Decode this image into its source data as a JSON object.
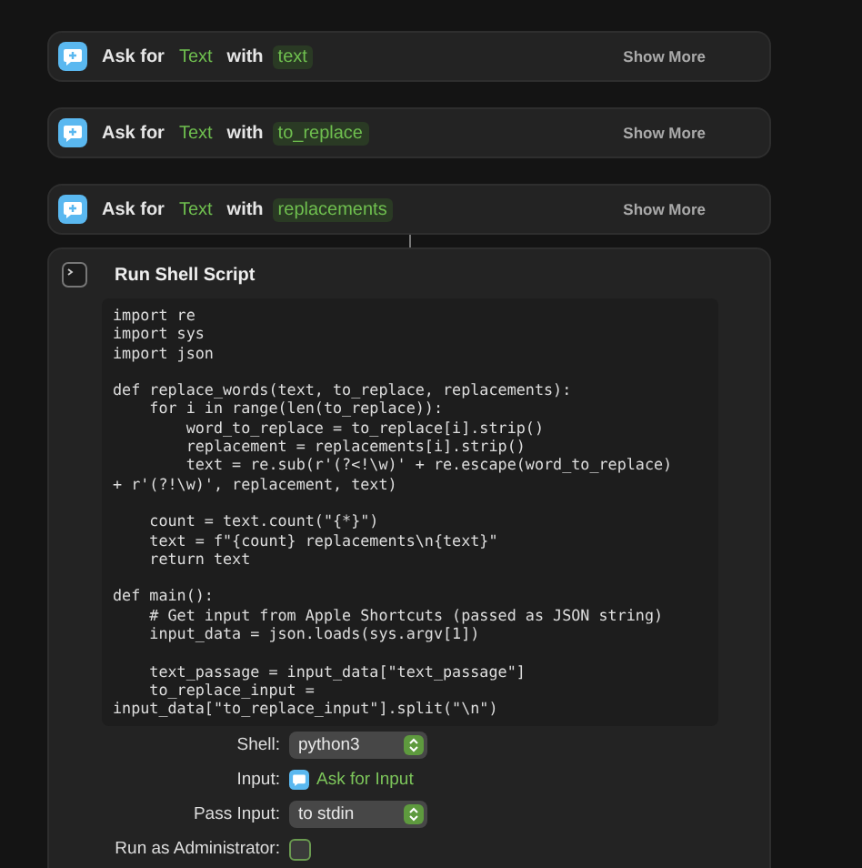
{
  "actions": [
    {
      "verb": "Ask for",
      "type": "Text",
      "with": "with",
      "variable": "text",
      "more": "Show More"
    },
    {
      "verb": "Ask for",
      "type": "Text",
      "with": "with",
      "variable": "to_replace",
      "more": "Show More"
    },
    {
      "verb": "Ask for",
      "type": "Text",
      "with": "with",
      "variable": "replacements",
      "more": "Show More"
    }
  ],
  "script_action": {
    "title": "Run Shell Script",
    "code": [
      [
        "import re",
        "import sys",
        "import json"
      ],
      [
        "def replace_words(text, to_replace, replacements):",
        "    for i in range(len(to_replace)):",
        "        word_to_replace = to_replace[i].strip()",
        "        replacement = replacements[i].strip()",
        "        text = re.sub(r'(?<!\\w)' + re.escape(word_to_replace)",
        "+ r'(?!\\w)', replacement, text)"
      ],
      [
        "    count = text.count(\"{*}\")",
        "    text = f\"{count} replacements\\n{text}\"",
        "    return text"
      ],
      [
        "def main():",
        "    # Get input from Apple Shortcuts (passed as JSON string)",
        "    input_data = json.loads(sys.argv[1])"
      ],
      [
        "    text_passage = input_data[\"text_passage\"]",
        "    to_replace_input =",
        "input_data[\"to_replace_input\"].split(\"\\n\")"
      ]
    ],
    "options": [
      {
        "kind": "popup",
        "label": "Shell:",
        "value": "python3"
      },
      {
        "kind": "variable",
        "label": "Input:",
        "value": "Ask for Input"
      },
      {
        "kind": "popup",
        "label": "Pass Input:",
        "value": "to stdin"
      },
      {
        "kind": "checkbox",
        "label": "Run as Administrator:",
        "checked": false
      }
    ]
  }
}
